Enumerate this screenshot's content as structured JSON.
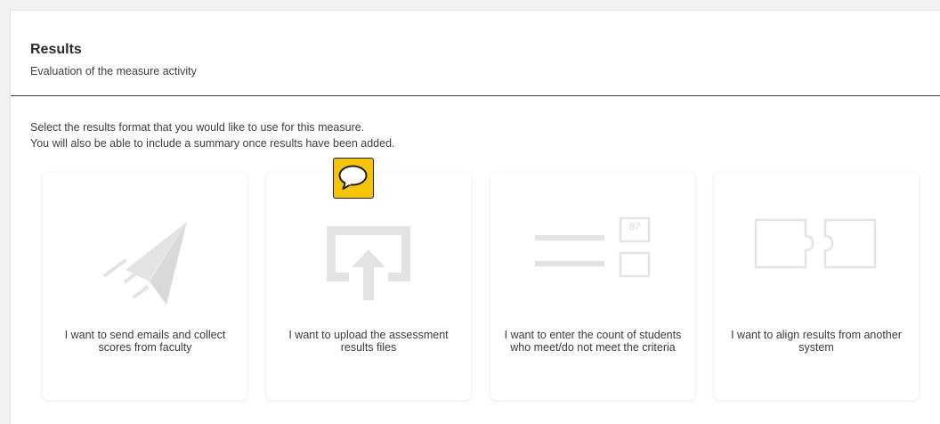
{
  "results": {
    "title": "Results",
    "subtitle": "Evaluation of the measure activity",
    "intro_line1": "Select the results format that you would like to use for this measure.",
    "intro_line2": "You will also be able to include a summary once results have been added."
  },
  "options": [
    {
      "label": "I want to send emails and collect scores from faculty",
      "icon": "paper-plane-icon"
    },
    {
      "label": "I want to upload the assessment results files",
      "icon": "upload-icon"
    },
    {
      "label": "I want to enter the count of students who meet/do not meet the criteria",
      "icon": "count-entry-icon",
      "sample_value": "87"
    },
    {
      "label": "I want to align results from another system",
      "icon": "puzzle-link-icon"
    }
  ],
  "comment_badge": {
    "icon": "speech-bubble-icon",
    "color": "#f6c400"
  },
  "colors": {
    "icon_gray": "#e3e3e6",
    "text": "#3a3a3a",
    "divider": "#3a3a3a"
  }
}
